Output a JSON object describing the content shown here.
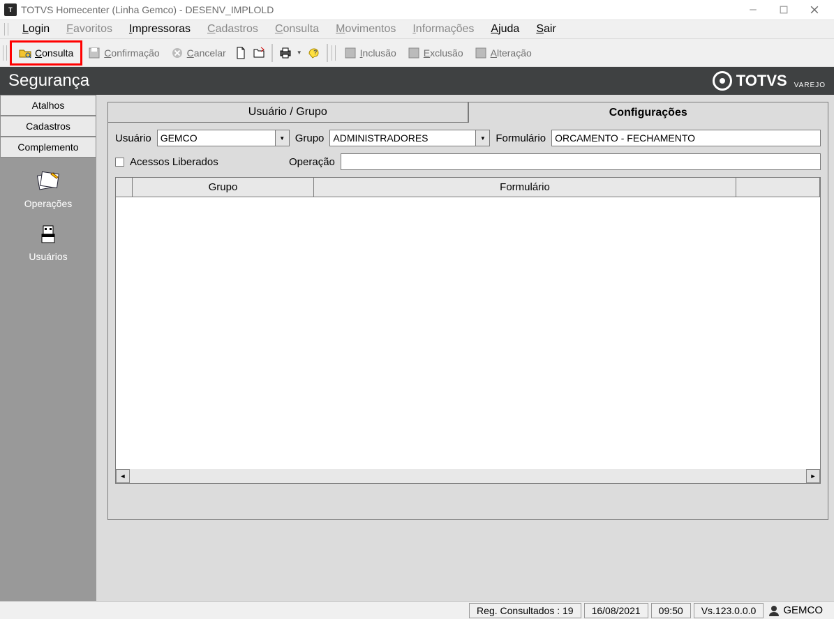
{
  "titlebar": {
    "title": "TOTVS Homecenter (Linha Gemco) - DESENV_IMPLOLD"
  },
  "menubar": {
    "items": [
      {
        "pre": "",
        "hot": "L",
        "post": "ogin",
        "enabled": true
      },
      {
        "pre": "",
        "hot": "F",
        "post": "avoritos",
        "enabled": false
      },
      {
        "pre": "",
        "hot": "I",
        "post": "mpressoras",
        "enabled": true
      },
      {
        "pre": "",
        "hot": "C",
        "post": "adastros",
        "enabled": false
      },
      {
        "pre": "",
        "hot": "C",
        "post": "onsulta",
        "enabled": false
      },
      {
        "pre": "",
        "hot": "M",
        "post": "ovimentos",
        "enabled": false
      },
      {
        "pre": "",
        "hot": "I",
        "post": "nformações",
        "enabled": false
      },
      {
        "pre": "",
        "hot": "A",
        "post": "juda",
        "enabled": true
      },
      {
        "pre": "",
        "hot": "S",
        "post": "air",
        "enabled": true
      }
    ]
  },
  "toolbar": {
    "consulta": "onsulta",
    "confirmacao": "onfirmação",
    "cancelar": "ancelar",
    "inclusao": "nclusão",
    "exclusao": "xclusão",
    "alteracao": "lteração"
  },
  "banner": {
    "title": "Segurança",
    "brand": "TOTVS",
    "brand_sub": "VAREJO"
  },
  "sidebar": {
    "tabs": [
      "Atalhos",
      "Cadastros",
      "Complemento"
    ],
    "items": [
      {
        "label": "Operações"
      },
      {
        "label": "Usuários"
      }
    ]
  },
  "content": {
    "tabs": [
      {
        "label": "Usuário  / Grupo",
        "active": false
      },
      {
        "label": "Configurações",
        "active": true
      }
    ],
    "form": {
      "usuario_label": "Usuário",
      "usuario_value": "GEMCO",
      "grupo_label": "Grupo",
      "grupo_value": "ADMINISTRADORES",
      "formulario_label": "Formulário",
      "formulario_value": "ORCAMENTO - FECHAMENTO",
      "acessos_label": "Acessos Liberados",
      "operacao_label": "Operação",
      "operacao_value": ""
    },
    "table": {
      "columns": [
        "",
        "Grupo",
        "Formulário",
        ""
      ]
    }
  },
  "statusbar": {
    "reg": "Reg. Consultados : 19",
    "date": "16/08/2021",
    "time": "09:50",
    "version": "Vs.123.0.0.0",
    "user": "GEMCO"
  }
}
